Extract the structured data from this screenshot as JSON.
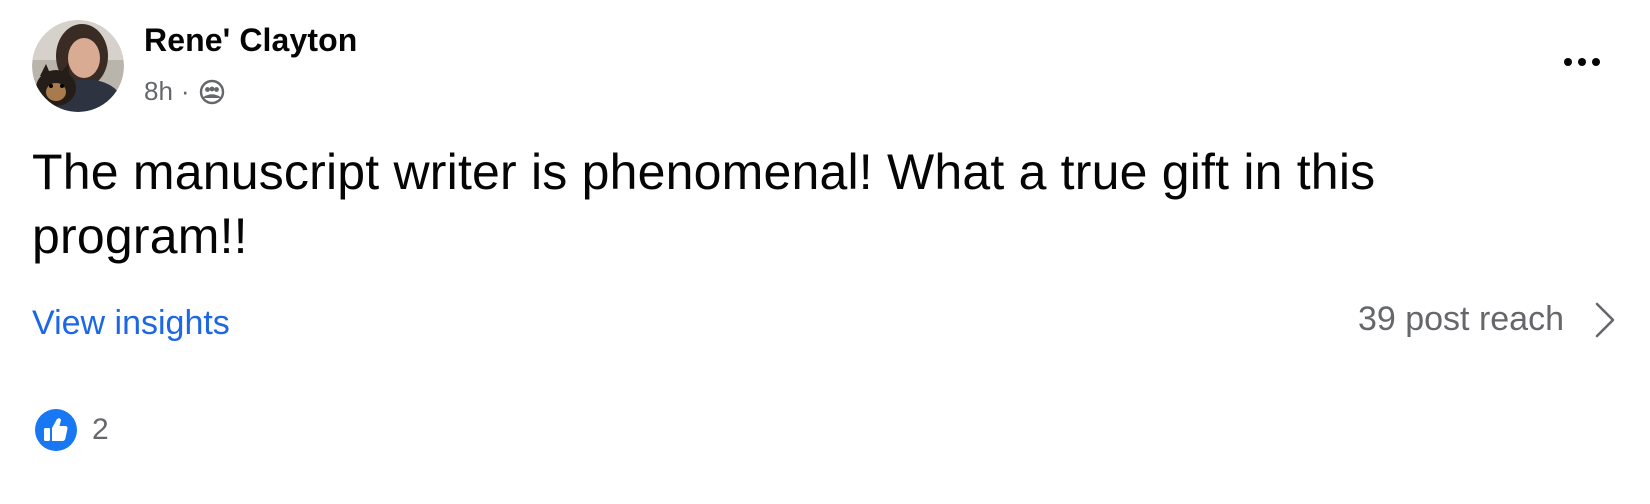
{
  "post": {
    "author": "Rene' Clayton",
    "time": "8h",
    "separator": "·",
    "audience_icon": "members-icon",
    "more_icon": "ellipsis-icon",
    "text": "The manuscript writer is phenomenal! What a true gift in this program!!",
    "insights_label": "View insights",
    "reach_label": "39 post reach",
    "reach_icon": "chevron-right-icon",
    "like_icon": "thumbs-up-icon",
    "reaction_count": "2",
    "colors": {
      "link": "#1b67e6",
      "like_badge": "#1877f2",
      "secondary_text": "#65676b"
    }
  }
}
